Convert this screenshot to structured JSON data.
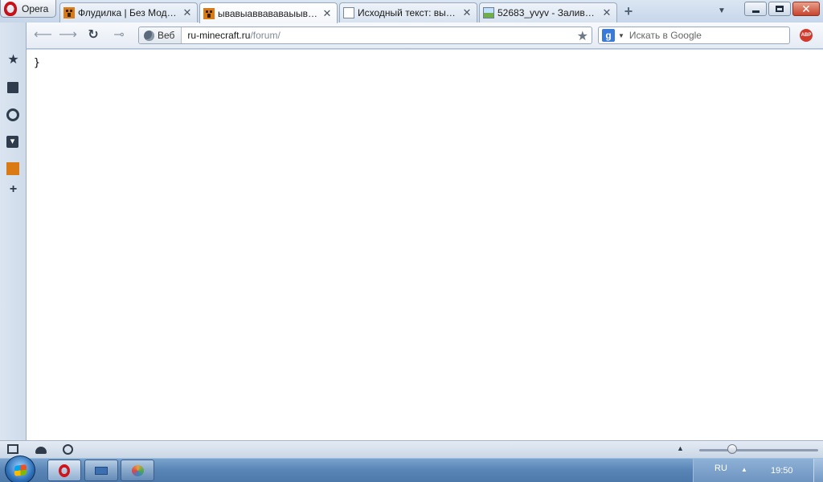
{
  "browser": {
    "menu_label": "Opera",
    "tabs": [
      {
        "title": "Флудилка | Без Модер...",
        "favicon": "creeper-icon",
        "active": false
      },
      {
        "title": "ывавыаввававаыывывы",
        "favicon": "creeper-icon",
        "active": true
      },
      {
        "title": "Исходный текст: выав...",
        "favicon": "document-icon",
        "active": false
      },
      {
        "title": "52683_yvyv - Заливка ...",
        "favicon": "image-icon",
        "active": false
      }
    ],
    "close_glyph": "✕",
    "new_tab_glyph": "+"
  },
  "address_bar": {
    "badge_label": "Веб",
    "url_host": "ru-minecraft.ru",
    "url_path": "/forum/"
  },
  "search": {
    "engine_letter": "g",
    "placeholder": "Искать в Google"
  },
  "extensions": {
    "adblock_label": "ABP"
  },
  "page": {
    "source_text": "}"
  },
  "status_bar": {
    "zoom_level": 0.28
  },
  "taskbar": {
    "language": "RU",
    "time": "19:50"
  }
}
